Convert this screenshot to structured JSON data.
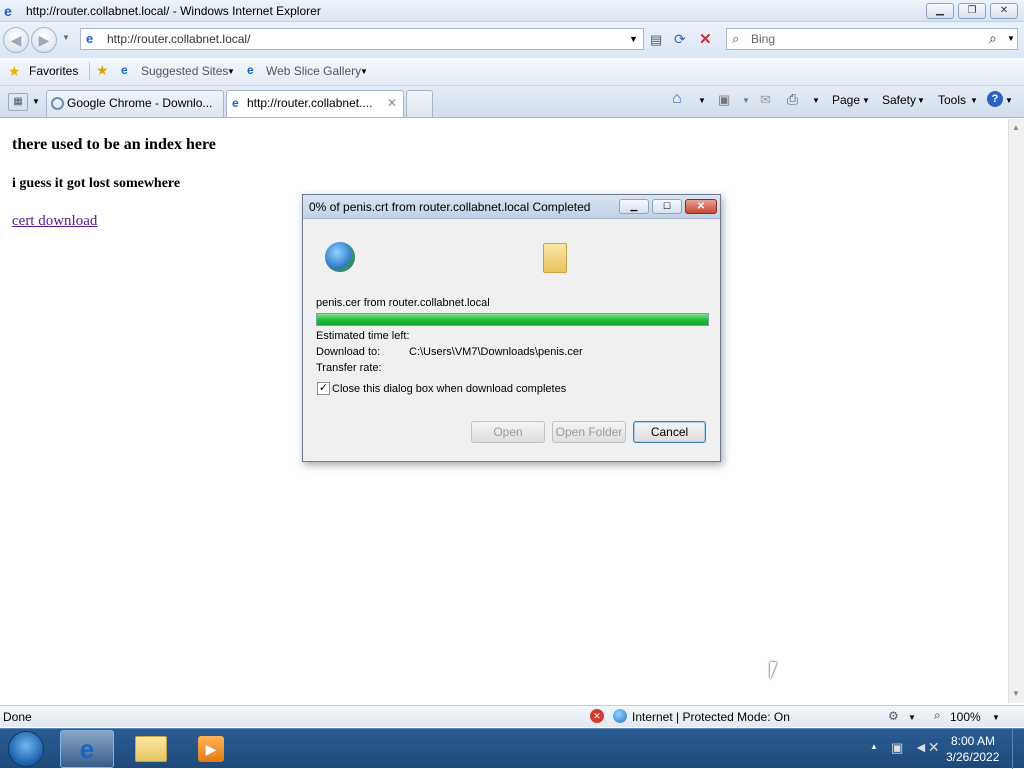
{
  "window": {
    "title": "http://router.collabnet.local/ - Windows Internet Explorer",
    "minimize": "▁",
    "restore": "❐",
    "close": "✕"
  },
  "nav": {
    "address": "http://router.collabnet.local/",
    "search_placeholder": "Bing"
  },
  "favorites_bar": {
    "favorites": "Favorites",
    "suggested_sites": "Suggested Sites",
    "web_slice_gallery": "Web Slice Gallery"
  },
  "tabs": [
    {
      "label": "Google Chrome - Downlo...",
      "active": false
    },
    {
      "label": "http://router.collabnet....",
      "active": true
    }
  ],
  "command_bar": {
    "page": "Page",
    "safety": "Safety",
    "tools": "Tools"
  },
  "page": {
    "heading": "there used to be an index here",
    "subheading": "i guess it got lost somewhere",
    "link": "cert download"
  },
  "dialog": {
    "title": "0% of penis.crt from router.collabnet.local Completed",
    "source": "penis.cer from router.collabnet.local",
    "progress": 1.0,
    "estimated_label": "Estimated time left:",
    "download_to_label": "Download to:",
    "download_to_value": "C:\\Users\\VM7\\Downloads\\penis.cer",
    "transfer_rate_label": "Transfer rate:",
    "close_checkbox_label": "Close this dialog box when download completes",
    "close_checkbox_checked": true,
    "open_button": "Open",
    "open_folder_button": "Open Folder",
    "cancel_button": "Cancel"
  },
  "status": {
    "left": "Done",
    "zone": "Internet | Protected Mode: On",
    "zoom": "100%"
  },
  "taskbar": {
    "time": "8:00 AM",
    "date": "3/26/2022"
  },
  "colors": {
    "progress": "#22c23a",
    "link": "#551a8b"
  }
}
